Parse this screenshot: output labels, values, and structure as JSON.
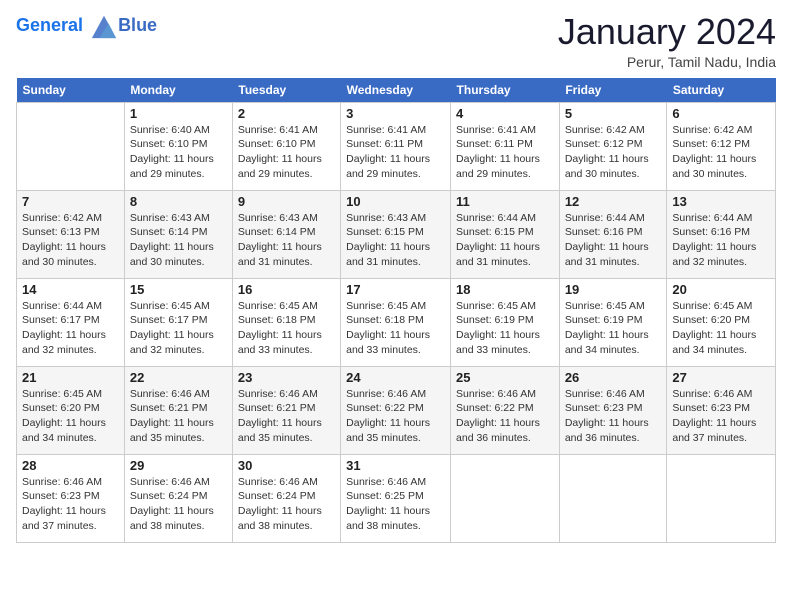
{
  "logo": {
    "line1": "General",
    "line2": "Blue"
  },
  "title": "January 2024",
  "subtitle": "Perur, Tamil Nadu, India",
  "days_of_week": [
    "Sunday",
    "Monday",
    "Tuesday",
    "Wednesday",
    "Thursday",
    "Friday",
    "Saturday"
  ],
  "weeks": [
    [
      {
        "day": "",
        "info": ""
      },
      {
        "day": "1",
        "info": "Sunrise: 6:40 AM\nSunset: 6:10 PM\nDaylight: 11 hours\nand 29 minutes."
      },
      {
        "day": "2",
        "info": "Sunrise: 6:41 AM\nSunset: 6:10 PM\nDaylight: 11 hours\nand 29 minutes."
      },
      {
        "day": "3",
        "info": "Sunrise: 6:41 AM\nSunset: 6:11 PM\nDaylight: 11 hours\nand 29 minutes."
      },
      {
        "day": "4",
        "info": "Sunrise: 6:41 AM\nSunset: 6:11 PM\nDaylight: 11 hours\nand 29 minutes."
      },
      {
        "day": "5",
        "info": "Sunrise: 6:42 AM\nSunset: 6:12 PM\nDaylight: 11 hours\nand 30 minutes."
      },
      {
        "day": "6",
        "info": "Sunrise: 6:42 AM\nSunset: 6:12 PM\nDaylight: 11 hours\nand 30 minutes."
      }
    ],
    [
      {
        "day": "7",
        "info": "Sunrise: 6:42 AM\nSunset: 6:13 PM\nDaylight: 11 hours\nand 30 minutes."
      },
      {
        "day": "8",
        "info": "Sunrise: 6:43 AM\nSunset: 6:14 PM\nDaylight: 11 hours\nand 30 minutes."
      },
      {
        "day": "9",
        "info": "Sunrise: 6:43 AM\nSunset: 6:14 PM\nDaylight: 11 hours\nand 31 minutes."
      },
      {
        "day": "10",
        "info": "Sunrise: 6:43 AM\nSunset: 6:15 PM\nDaylight: 11 hours\nand 31 minutes."
      },
      {
        "day": "11",
        "info": "Sunrise: 6:44 AM\nSunset: 6:15 PM\nDaylight: 11 hours\nand 31 minutes."
      },
      {
        "day": "12",
        "info": "Sunrise: 6:44 AM\nSunset: 6:16 PM\nDaylight: 11 hours\nand 31 minutes."
      },
      {
        "day": "13",
        "info": "Sunrise: 6:44 AM\nSunset: 6:16 PM\nDaylight: 11 hours\nand 32 minutes."
      }
    ],
    [
      {
        "day": "14",
        "info": "Sunrise: 6:44 AM\nSunset: 6:17 PM\nDaylight: 11 hours\nand 32 minutes."
      },
      {
        "day": "15",
        "info": "Sunrise: 6:45 AM\nSunset: 6:17 PM\nDaylight: 11 hours\nand 32 minutes."
      },
      {
        "day": "16",
        "info": "Sunrise: 6:45 AM\nSunset: 6:18 PM\nDaylight: 11 hours\nand 33 minutes."
      },
      {
        "day": "17",
        "info": "Sunrise: 6:45 AM\nSunset: 6:18 PM\nDaylight: 11 hours\nand 33 minutes."
      },
      {
        "day": "18",
        "info": "Sunrise: 6:45 AM\nSunset: 6:19 PM\nDaylight: 11 hours\nand 33 minutes."
      },
      {
        "day": "19",
        "info": "Sunrise: 6:45 AM\nSunset: 6:19 PM\nDaylight: 11 hours\nand 34 minutes."
      },
      {
        "day": "20",
        "info": "Sunrise: 6:45 AM\nSunset: 6:20 PM\nDaylight: 11 hours\nand 34 minutes."
      }
    ],
    [
      {
        "day": "21",
        "info": "Sunrise: 6:45 AM\nSunset: 6:20 PM\nDaylight: 11 hours\nand 34 minutes."
      },
      {
        "day": "22",
        "info": "Sunrise: 6:46 AM\nSunset: 6:21 PM\nDaylight: 11 hours\nand 35 minutes."
      },
      {
        "day": "23",
        "info": "Sunrise: 6:46 AM\nSunset: 6:21 PM\nDaylight: 11 hours\nand 35 minutes."
      },
      {
        "day": "24",
        "info": "Sunrise: 6:46 AM\nSunset: 6:22 PM\nDaylight: 11 hours\nand 35 minutes."
      },
      {
        "day": "25",
        "info": "Sunrise: 6:46 AM\nSunset: 6:22 PM\nDaylight: 11 hours\nand 36 minutes."
      },
      {
        "day": "26",
        "info": "Sunrise: 6:46 AM\nSunset: 6:23 PM\nDaylight: 11 hours\nand 36 minutes."
      },
      {
        "day": "27",
        "info": "Sunrise: 6:46 AM\nSunset: 6:23 PM\nDaylight: 11 hours\nand 37 minutes."
      }
    ],
    [
      {
        "day": "28",
        "info": "Sunrise: 6:46 AM\nSunset: 6:23 PM\nDaylight: 11 hours\nand 37 minutes."
      },
      {
        "day": "29",
        "info": "Sunrise: 6:46 AM\nSunset: 6:24 PM\nDaylight: 11 hours\nand 38 minutes."
      },
      {
        "day": "30",
        "info": "Sunrise: 6:46 AM\nSunset: 6:24 PM\nDaylight: 11 hours\nand 38 minutes."
      },
      {
        "day": "31",
        "info": "Sunrise: 6:46 AM\nSunset: 6:25 PM\nDaylight: 11 hours\nand 38 minutes."
      },
      {
        "day": "",
        "info": ""
      },
      {
        "day": "",
        "info": ""
      },
      {
        "day": "",
        "info": ""
      }
    ]
  ]
}
